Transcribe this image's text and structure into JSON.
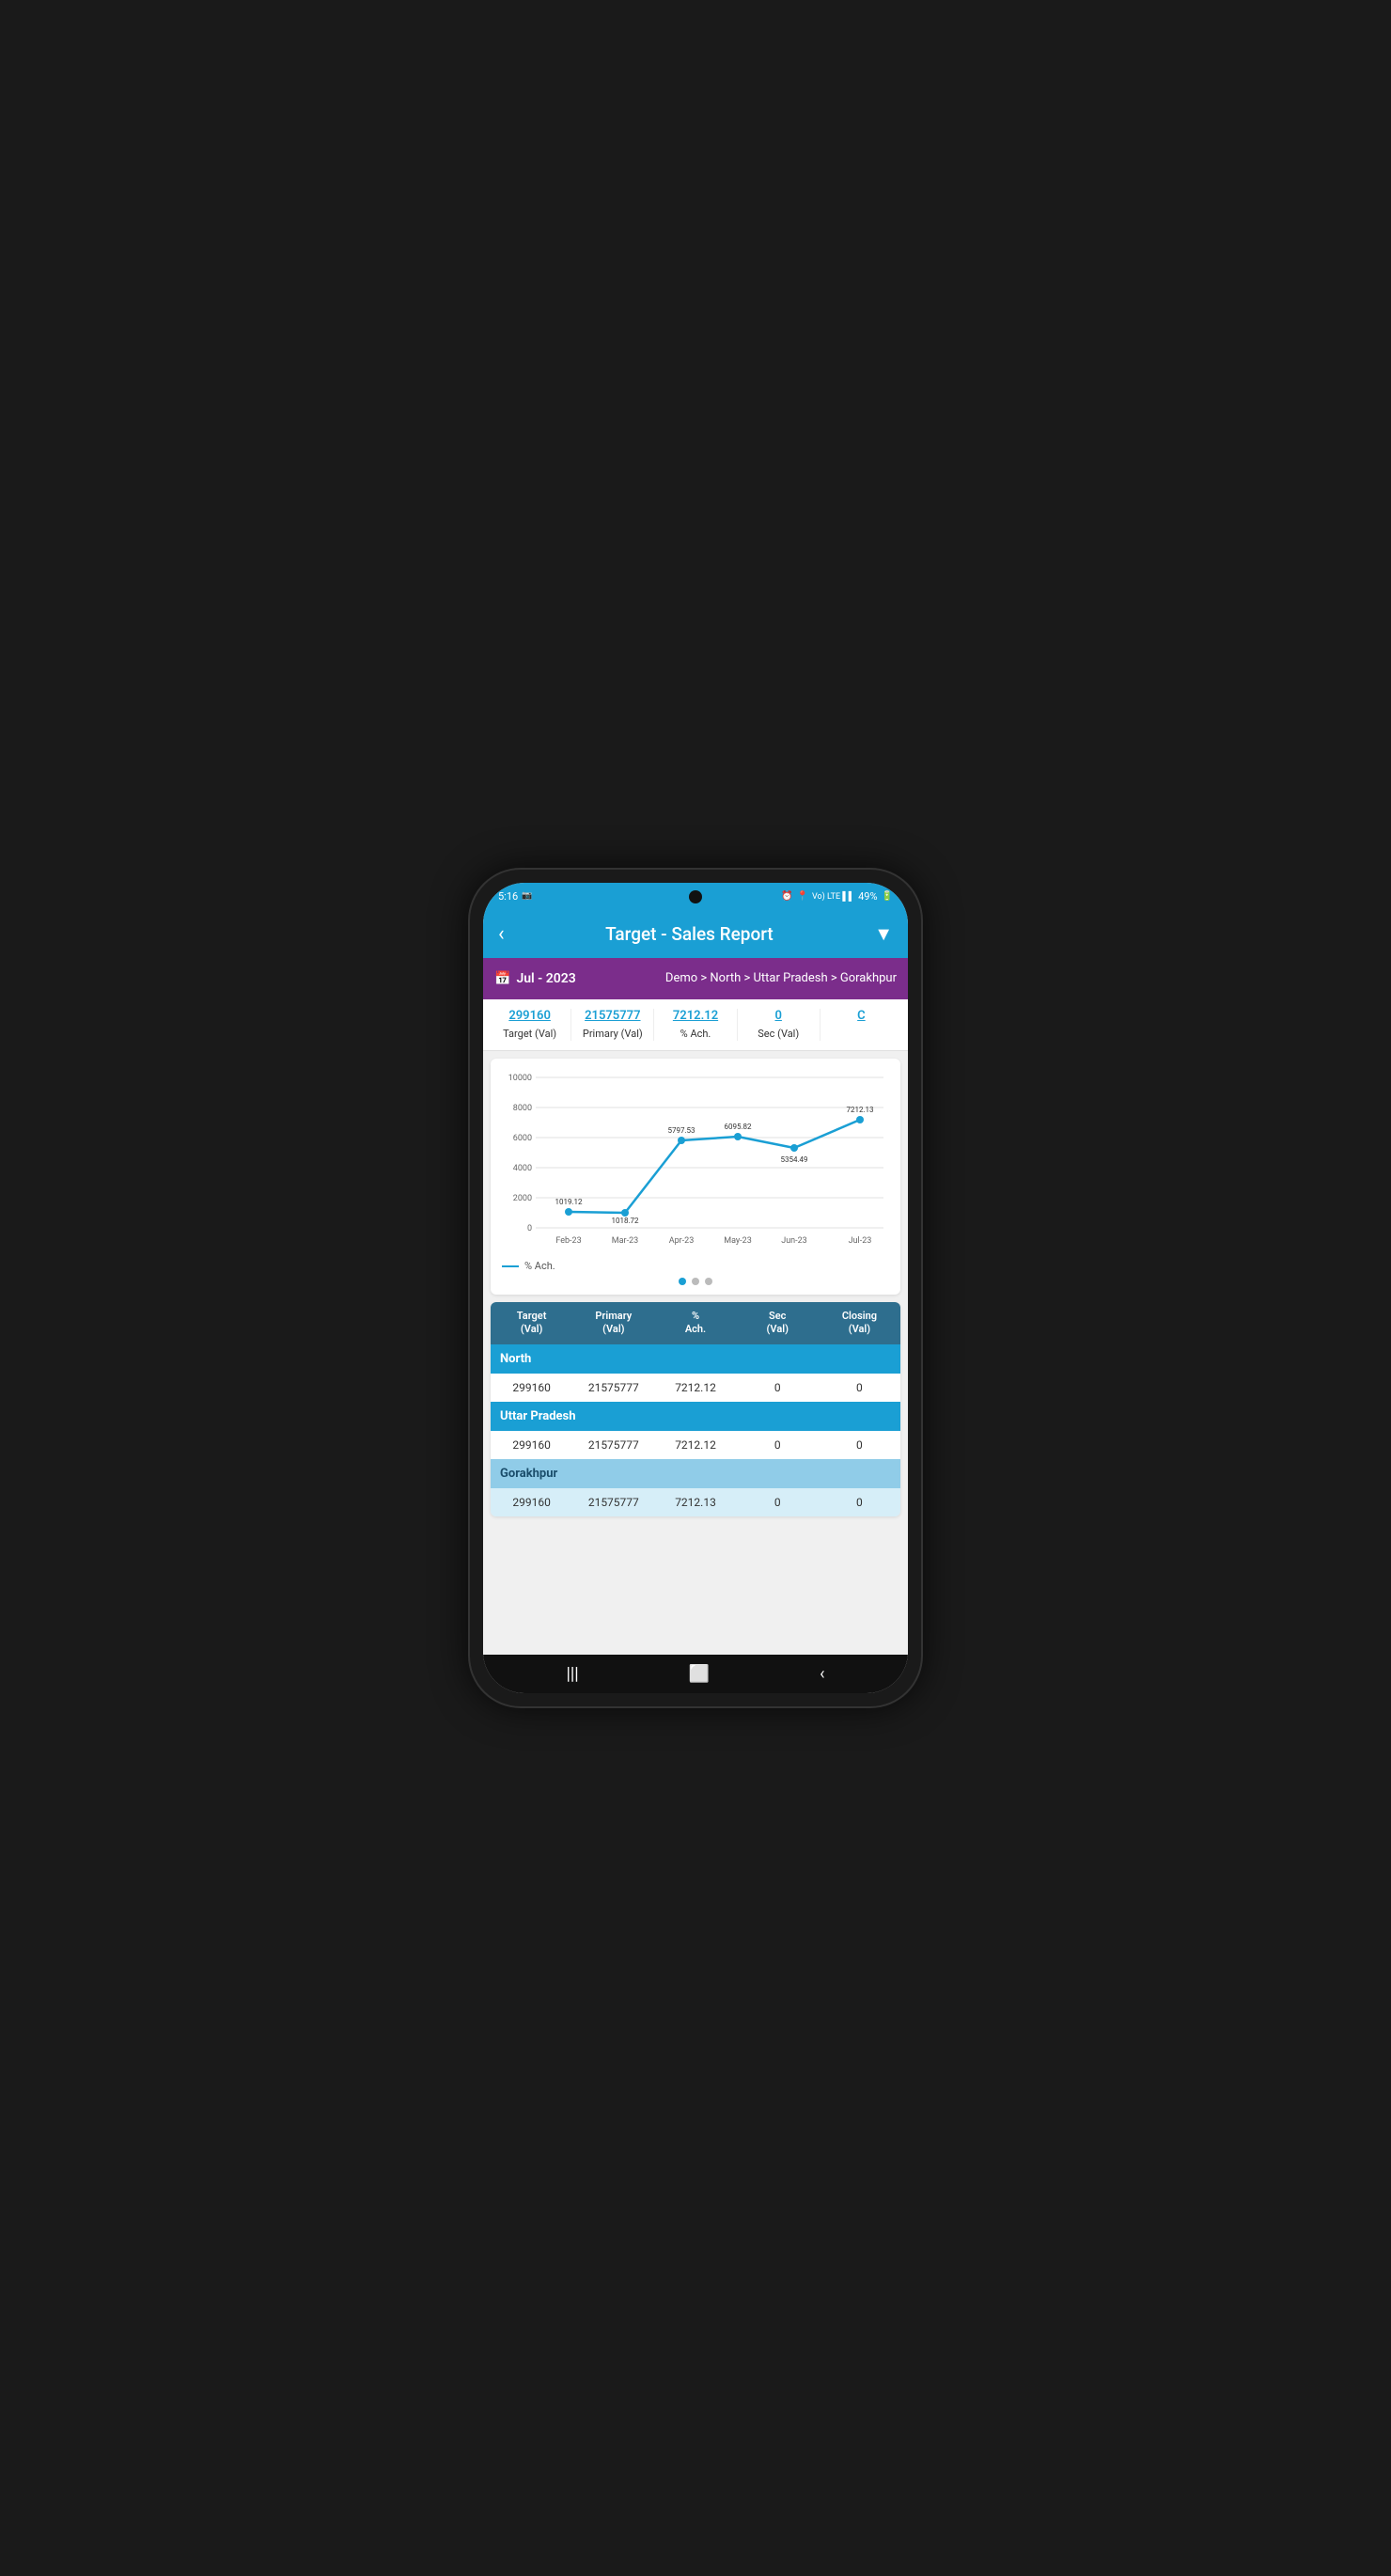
{
  "statusBar": {
    "time": "5:16",
    "battery": "49%",
    "icons": [
      "alarm",
      "location",
      "signal"
    ]
  },
  "appBar": {
    "title": "Target - Sales Report",
    "backLabel": "‹",
    "filterLabel": "▼"
  },
  "dateBar": {
    "calendarIcon": "📅",
    "date": "Jul - 2023",
    "breadcrumb": "Demo > North > Uttar Pradesh > Gorakhpur"
  },
  "summary": [
    {
      "value": "299160",
      "label": "Target (Val)"
    },
    {
      "value": "21575777",
      "label": "Primary (Val)"
    },
    {
      "value": "7212.12",
      "label": "% Ach."
    },
    {
      "value": "0",
      "label": "Sec (Val)"
    },
    {
      "value": "C",
      "label": ""
    }
  ],
  "chart": {
    "yAxisLabels": [
      "10000",
      "8000",
      "6000",
      "4000",
      "2000",
      "0"
    ],
    "xAxisLabels": [
      "Feb-23",
      "Mar-23",
      "Apr-23",
      "May-23",
      "Jun-23",
      "Jul-23"
    ],
    "dataPoints": [
      {
        "month": "Feb-23",
        "value": 1019.12,
        "label": "1019.12"
      },
      {
        "month": "Mar-23",
        "value": 1018.72,
        "label": "1018.72"
      },
      {
        "month": "Apr-23",
        "value": 5797.53,
        "label": "5797.53"
      },
      {
        "month": "May-23",
        "value": 6095.82,
        "label": "6095.82"
      },
      {
        "month": "Jun-23",
        "value": 5354.49,
        "label": "5354.49"
      },
      {
        "month": "Jul-23",
        "value": 7212.13,
        "label": "7212.13"
      }
    ],
    "legendLabel": "% Ach.",
    "maxValue": 10000
  },
  "table": {
    "headers": [
      "Target\n(Val)",
      "Primary\n(Val)",
      "%\nAch.",
      "Sec\n(Val)",
      "Closing\n(Val)"
    ],
    "sections": [
      {
        "name": "North",
        "style": "north",
        "rows": [
          {
            "target": "299160",
            "primary": "21575777",
            "ach": "7212.12",
            "sec": "0",
            "closing": "0"
          }
        ]
      },
      {
        "name": "Uttar Pradesh",
        "style": "up",
        "rows": [
          {
            "target": "299160",
            "primary": "21575777",
            "ach": "7212.12",
            "sec": "0",
            "closing": "0"
          }
        ]
      },
      {
        "name": "Gorakhpur",
        "style": "gorakhpur",
        "rows": [
          {
            "target": "299160",
            "primary": "21575777",
            "ach": "7212.13",
            "sec": "0",
            "closing": "0"
          }
        ]
      }
    ]
  },
  "colors": {
    "appBar": "#1a9fd4",
    "datebar": "#7b2d8b",
    "tableHeader": "#2e6e8e",
    "sectionNorth": "#1a9fd4",
    "sectionGorakhpur": "#90cce8",
    "chartLine": "#1a9fd4"
  }
}
